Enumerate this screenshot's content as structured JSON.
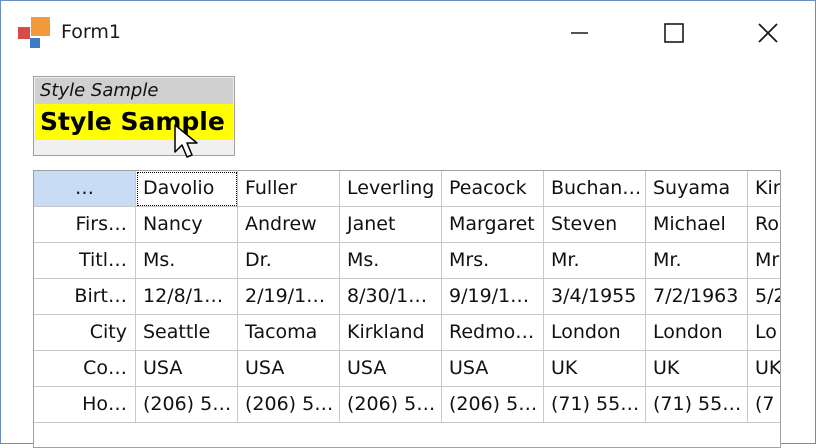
{
  "window": {
    "title": "Form1"
  },
  "style_sample": {
    "line1": "Style Sample",
    "line2": "Style Sample",
    "line2_background": "#ffff00"
  },
  "grid": {
    "columns": [
      "Davolio",
      "Fuller",
      "Leverling",
      "Peacock",
      "Buchan…",
      "Suyama",
      "Kir"
    ],
    "corner_label": "…",
    "rows": [
      {
        "label": "Firs…",
        "cells": [
          "Nancy",
          "Andrew",
          "Janet",
          "Margaret",
          "Steven",
          "Michael",
          "Ro"
        ]
      },
      {
        "label": "Titl…",
        "cells": [
          "Ms.",
          "Dr.",
          "Ms.",
          "Mrs.",
          "Mr.",
          "Mr.",
          "Mr"
        ]
      },
      {
        "label": "Birt…",
        "cells": [
          "12/8/1…",
          "2/19/1…",
          "8/30/1…",
          "9/19/1…",
          "3/4/1955",
          "7/2/1963",
          "5/2"
        ]
      },
      {
        "label": "City",
        "cells": [
          "Seattle",
          "Tacoma",
          "Kirkland",
          "Redmo…",
          "London",
          "London",
          "Lo"
        ]
      },
      {
        "label": "Co…",
        "cells": [
          "USA",
          "USA",
          "USA",
          "USA",
          "UK",
          "UK",
          "UK"
        ]
      },
      {
        "label": "Ho…",
        "cells": [
          "(206) 5…",
          "(206) 5…",
          "(206) 5…",
          "(206) 5…",
          "(71) 55…",
          "(71) 55…",
          "(7"
        ]
      }
    ]
  }
}
